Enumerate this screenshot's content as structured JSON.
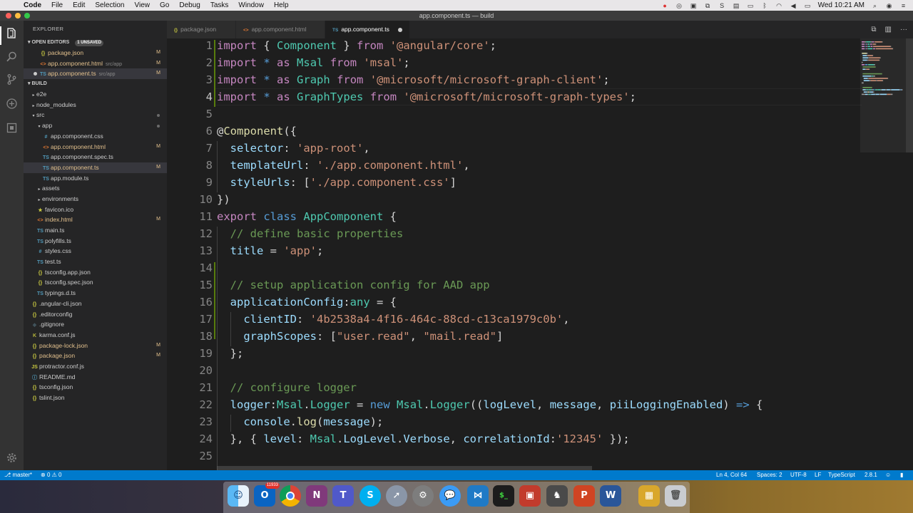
{
  "menubar": {
    "app_name": "Code",
    "items": [
      "File",
      "Edit",
      "Selection",
      "View",
      "Go",
      "Debug",
      "Tasks",
      "Window",
      "Help"
    ],
    "clock": "Wed 10:21 AM"
  },
  "window": {
    "title": "app.component.ts — build"
  },
  "sidebar": {
    "title": "EXPLORER",
    "open_editors": {
      "label": "OPEN EDITORS",
      "unsaved_badge": "1 UNSAVED",
      "items": [
        {
          "icon": "{}",
          "name": "package.json",
          "desc": "",
          "badge": "M"
        },
        {
          "icon": "<>",
          "name": "app.component.html",
          "desc": "src/app",
          "badge": "M"
        },
        {
          "icon": "TS",
          "name": "app.component.ts",
          "desc": "src/app",
          "badge": "M"
        }
      ]
    },
    "project": {
      "label": "BUILD",
      "items": [
        {
          "indent": 1,
          "caret": "▸",
          "icon": "",
          "name": "e2e",
          "badge": ""
        },
        {
          "indent": 1,
          "caret": "▸",
          "icon": "",
          "name": "node_modules",
          "badge": ""
        },
        {
          "indent": 1,
          "caret": "▾",
          "icon": "",
          "name": "src",
          "badge": ""
        },
        {
          "indent": 2,
          "caret": "▾",
          "icon": "",
          "name": "app",
          "badge": ""
        },
        {
          "indent": 3,
          "caret": "",
          "icon": "#",
          "name": "app.component.css",
          "badge": ""
        },
        {
          "indent": 3,
          "caret": "",
          "icon": "<>",
          "name": "app.component.html",
          "badge": "M"
        },
        {
          "indent": 3,
          "caret": "",
          "icon": "TS",
          "name": "app.component.spec.ts",
          "badge": ""
        },
        {
          "indent": 3,
          "caret": "",
          "icon": "TS",
          "name": "app.component.ts",
          "badge": "M"
        },
        {
          "indent": 3,
          "caret": "",
          "icon": "TS",
          "name": "app.module.ts",
          "badge": ""
        },
        {
          "indent": 2,
          "caret": "▸",
          "icon": "",
          "name": "assets",
          "badge": ""
        },
        {
          "indent": 2,
          "caret": "▸",
          "icon": "",
          "name": "environments",
          "badge": ""
        },
        {
          "indent": 2,
          "caret": "",
          "icon": "★",
          "name": "favicon.ico",
          "badge": ""
        },
        {
          "indent": 2,
          "caret": "",
          "icon": "<>",
          "name": "index.html",
          "badge": "M"
        },
        {
          "indent": 2,
          "caret": "",
          "icon": "TS",
          "name": "main.ts",
          "badge": ""
        },
        {
          "indent": 2,
          "caret": "",
          "icon": "TS",
          "name": "polyfills.ts",
          "badge": ""
        },
        {
          "indent": 2,
          "caret": "",
          "icon": "#",
          "name": "styles.css",
          "badge": ""
        },
        {
          "indent": 2,
          "caret": "",
          "icon": "TS",
          "name": "test.ts",
          "badge": ""
        },
        {
          "indent": 2,
          "caret": "",
          "icon": "{}",
          "name": "tsconfig.app.json",
          "badge": ""
        },
        {
          "indent": 2,
          "caret": "",
          "icon": "{}",
          "name": "tsconfig.spec.json",
          "badge": ""
        },
        {
          "indent": 2,
          "caret": "",
          "icon": "TS",
          "name": "typings.d.ts",
          "badge": ""
        },
        {
          "indent": 1,
          "caret": "",
          "icon": "{}",
          "name": ".angular-cli.json",
          "badge": ""
        },
        {
          "indent": 1,
          "caret": "",
          "icon": "{}",
          "name": ".editorconfig",
          "badge": ""
        },
        {
          "indent": 1,
          "caret": "",
          "icon": "◆",
          "name": ".gitignore",
          "badge": ""
        },
        {
          "indent": 1,
          "caret": "",
          "icon": "K",
          "name": "karma.conf.js",
          "badge": ""
        },
        {
          "indent": 1,
          "caret": "",
          "icon": "{}",
          "name": "package-lock.json",
          "badge": "M"
        },
        {
          "indent": 1,
          "caret": "",
          "icon": "{}",
          "name": "package.json",
          "badge": "M"
        },
        {
          "indent": 1,
          "caret": "",
          "icon": "JS",
          "name": "protractor.conf.js",
          "badge": ""
        },
        {
          "indent": 1,
          "caret": "",
          "icon": "ⓘ",
          "name": "README.md",
          "badge": ""
        },
        {
          "indent": 1,
          "caret": "",
          "icon": "{}",
          "name": "tsconfig.json",
          "badge": ""
        },
        {
          "indent": 1,
          "caret": "",
          "icon": "{}",
          "name": "tslint.json",
          "badge": ""
        }
      ]
    }
  },
  "tabs": [
    {
      "icon": "{}",
      "label": "package.json",
      "active": false
    },
    {
      "icon": "<>",
      "label": "app.component.html",
      "active": false
    },
    {
      "icon": "TS",
      "label": "app.component.ts",
      "active": true
    }
  ],
  "editor": {
    "current_line": 4,
    "lines": [
      [
        [
          "kw",
          "import"
        ],
        [
          "pn",
          " { "
        ],
        [
          "cls",
          "Component"
        ],
        [
          "pn",
          " } "
        ],
        [
          "kw",
          "from"
        ],
        [
          "pn",
          " "
        ],
        [
          "str",
          "'@angular/core'"
        ],
        [
          "pn",
          ";"
        ]
      ],
      [
        [
          "kw",
          "import"
        ],
        [
          "pn",
          " "
        ],
        [
          "kb",
          "*"
        ],
        [
          "pn",
          " "
        ],
        [
          "kw",
          "as"
        ],
        [
          "pn",
          " "
        ],
        [
          "cls",
          "Msal"
        ],
        [
          "pn",
          " "
        ],
        [
          "kw",
          "from"
        ],
        [
          "pn",
          " "
        ],
        [
          "str",
          "'msal'"
        ],
        [
          "pn",
          ";"
        ]
      ],
      [
        [
          "kw",
          "import"
        ],
        [
          "pn",
          " "
        ],
        [
          "kb",
          "*"
        ],
        [
          "pn",
          " "
        ],
        [
          "kw",
          "as"
        ],
        [
          "pn",
          " "
        ],
        [
          "cls",
          "Graph"
        ],
        [
          "pn",
          " "
        ],
        [
          "kw",
          "from"
        ],
        [
          "pn",
          " "
        ],
        [
          "str",
          "'@microsoft/microsoft-graph-client'"
        ],
        [
          "pn",
          ";"
        ]
      ],
      [
        [
          "kw",
          "import"
        ],
        [
          "pn",
          " "
        ],
        [
          "kb",
          "*"
        ],
        [
          "pn",
          " "
        ],
        [
          "kw",
          "as"
        ],
        [
          "pn",
          " "
        ],
        [
          "cls",
          "GraphTypes"
        ],
        [
          "pn",
          " "
        ],
        [
          "kw",
          "from"
        ],
        [
          "pn",
          " "
        ],
        [
          "str",
          "'@microsoft/microsoft-graph-types'"
        ],
        [
          "pn",
          ";"
        ]
      ],
      [],
      [
        [
          "pn",
          "@"
        ],
        [
          "fn",
          "Component"
        ],
        [
          "pn",
          "({"
        ]
      ],
      [
        [
          "pn",
          "  "
        ],
        [
          "prop",
          "selector"
        ],
        [
          "pn",
          ": "
        ],
        [
          "str",
          "'app-root'"
        ],
        [
          "pn",
          ","
        ]
      ],
      [
        [
          "pn",
          "  "
        ],
        [
          "prop",
          "templateUrl"
        ],
        [
          "pn",
          ": "
        ],
        [
          "str",
          "'./app.component.html'"
        ],
        [
          "pn",
          ","
        ]
      ],
      [
        [
          "pn",
          "  "
        ],
        [
          "prop",
          "styleUrls"
        ],
        [
          "pn",
          ": ["
        ],
        [
          "str",
          "'./app.component.css'"
        ],
        [
          "pn",
          "]"
        ]
      ],
      [
        [
          "pn",
          "})"
        ]
      ],
      [
        [
          "kw",
          "export"
        ],
        [
          "pn",
          " "
        ],
        [
          "kb",
          "class"
        ],
        [
          "pn",
          " "
        ],
        [
          "cls",
          "AppComponent"
        ],
        [
          "pn",
          " {"
        ]
      ],
      [
        [
          "pn",
          "  "
        ],
        [
          "cmt",
          "// define basic properties"
        ]
      ],
      [
        [
          "pn",
          "  "
        ],
        [
          "prop",
          "title"
        ],
        [
          "pn",
          " = "
        ],
        [
          "str",
          "'app'"
        ],
        [
          "pn",
          ";"
        ]
      ],
      [],
      [
        [
          "pn",
          "  "
        ],
        [
          "cmt",
          "// setup application config for AAD app"
        ]
      ],
      [
        [
          "pn",
          "  "
        ],
        [
          "prop",
          "applicationConfig"
        ],
        [
          "pn",
          ":"
        ],
        [
          "cls",
          "any"
        ],
        [
          "pn",
          " = {"
        ]
      ],
      [
        [
          "pn",
          "    "
        ],
        [
          "prop",
          "clientID"
        ],
        [
          "pn",
          ": "
        ],
        [
          "str",
          "'4b2538a4-4f16-464c-88cd-c13ca1979c0b'"
        ],
        [
          "pn",
          ","
        ]
      ],
      [
        [
          "pn",
          "    "
        ],
        [
          "prop",
          "graphScopes"
        ],
        [
          "pn",
          ": ["
        ],
        [
          "str",
          "\"user.read\""
        ],
        [
          "pn",
          ", "
        ],
        [
          "str",
          "\"mail.read\""
        ],
        [
          "pn",
          "]"
        ]
      ],
      [
        [
          "pn",
          "  };"
        ]
      ],
      [],
      [
        [
          "pn",
          "  "
        ],
        [
          "cmt",
          "// configure logger"
        ]
      ],
      [
        [
          "pn",
          "  "
        ],
        [
          "prop",
          "logger"
        ],
        [
          "pn",
          ":"
        ],
        [
          "cls",
          "Msal"
        ],
        [
          "pn",
          "."
        ],
        [
          "cls",
          "Logger"
        ],
        [
          "pn",
          " = "
        ],
        [
          "kb",
          "new"
        ],
        [
          "pn",
          " "
        ],
        [
          "cls",
          "Msal"
        ],
        [
          "pn",
          "."
        ],
        [
          "cls",
          "Logger"
        ],
        [
          "pn",
          "(("
        ],
        [
          "prop",
          "logLevel"
        ],
        [
          "pn",
          ", "
        ],
        [
          "prop",
          "message"
        ],
        [
          "pn",
          ", "
        ],
        [
          "prop",
          "piiLoggingEnabled"
        ],
        [
          "pn",
          ") "
        ],
        [
          "kb",
          "=>"
        ],
        [
          "pn",
          " {"
        ]
      ],
      [
        [
          "pn",
          "    "
        ],
        [
          "prop",
          "console"
        ],
        [
          "pn",
          "."
        ],
        [
          "fn",
          "log"
        ],
        [
          "pn",
          "("
        ],
        [
          "prop",
          "message"
        ],
        [
          "pn",
          ");"
        ]
      ],
      [
        [
          "pn",
          "  }, { "
        ],
        [
          "prop",
          "level"
        ],
        [
          "pn",
          ": "
        ],
        [
          "cls",
          "Msal"
        ],
        [
          "pn",
          "."
        ],
        [
          "prop",
          "LogLevel"
        ],
        [
          "pn",
          "."
        ],
        [
          "prop",
          "Verbose"
        ],
        [
          "pn",
          ", "
        ],
        [
          "prop",
          "correlationId"
        ],
        [
          "pn",
          ":"
        ],
        [
          "str",
          "'12345'"
        ],
        [
          "pn",
          " });"
        ]
      ],
      []
    ]
  },
  "statusbar": {
    "branch": "master*",
    "problems": "0",
    "warnings": "0",
    "position": "Ln 4, Col 64",
    "spaces": "Spaces: 2",
    "encoding": "UTF-8",
    "eol": "LF",
    "language": "TypeScript",
    "version": "2.8.1"
  },
  "dock": {
    "outlook_badge": "11933",
    "icons": [
      "finder-icon",
      "outlook-icon",
      "chrome-icon",
      "onenote-icon",
      "teams-icon",
      "skype-icon",
      "launchpad-icon",
      "system-preferences-icon",
      "messages-icon",
      "vscode-icon",
      "terminal-icon",
      "vmware-icon",
      "app-icon",
      "powerpoint-icon",
      "word-icon",
      "stack-icon",
      "trash-icon"
    ]
  },
  "colors": {
    "accent": "#007acc",
    "keyword": "#c586c0",
    "string": "#ce9178",
    "type": "#4ec9b0",
    "property": "#9cdcfe",
    "comment": "#6a9955",
    "modified": "#e2c08d"
  }
}
